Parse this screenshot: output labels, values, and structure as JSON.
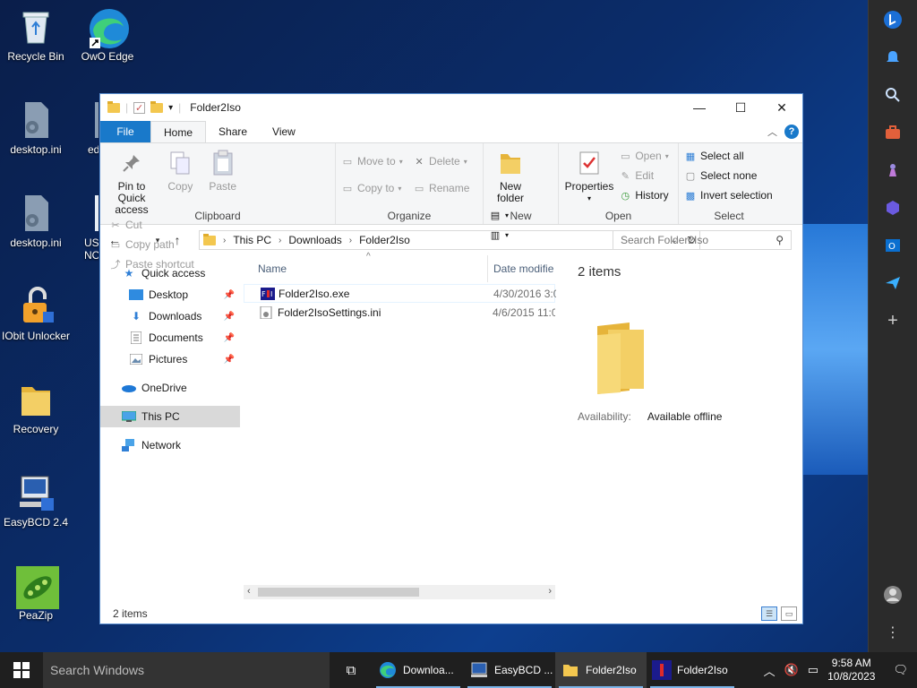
{
  "desktop": {
    "icons": [
      {
        "label": "Recycle Bin"
      },
      {
        "label": "OwO Edge"
      },
      {
        "label": "desktop.ini"
      },
      {
        "label": "ed"
      },
      {
        "label": "desktop.ini"
      },
      {
        "label": "USE NOW"
      },
      {
        "label": "IObit Unlocker"
      },
      {
        "label": "Recovery"
      },
      {
        "label": "EasyBCD 2.4"
      },
      {
        "label": "PeaZip"
      }
    ]
  },
  "window": {
    "title": "Folder2Iso",
    "controls": {
      "minimize": "—",
      "maximize": "☐",
      "close": "✕"
    }
  },
  "ribbon": {
    "tabs": {
      "file": "File",
      "home": "Home",
      "share": "Share",
      "view": "View"
    },
    "clipboard": {
      "group": "Clipboard",
      "pin": "Pin to Quick access",
      "copy": "Copy",
      "paste": "Paste",
      "cut": "Cut",
      "copy_path": "Copy path",
      "paste_shortcut": "Paste shortcut"
    },
    "organize": {
      "group": "Organize",
      "move_to": "Move to",
      "copy_to": "Copy to",
      "delete": "Delete",
      "rename": "Rename"
    },
    "new": {
      "group": "New",
      "new_folder": "New folder"
    },
    "open": {
      "group": "Open",
      "properties": "Properties",
      "open": "Open",
      "edit": "Edit",
      "history": "History"
    },
    "select": {
      "group": "Select",
      "select_all": "Select all",
      "select_none": "Select none",
      "invert": "Invert selection"
    }
  },
  "address": {
    "crumbs": [
      "This PC",
      "Downloads",
      "Folder2Iso"
    ],
    "search_placeholder": "Search Folder2Iso"
  },
  "nav": {
    "quick_access": "Quick access",
    "items": [
      {
        "label": "Desktop"
      },
      {
        "label": "Downloads"
      },
      {
        "label": "Documents"
      },
      {
        "label": "Pictures"
      }
    ],
    "onedrive": "OneDrive",
    "this_pc": "This PC",
    "network": "Network"
  },
  "files": {
    "col_name": "Name",
    "col_date": "Date modifie",
    "rows": [
      {
        "name": "Folder2Iso.exe",
        "date": "4/30/2016 3:0"
      },
      {
        "name": "Folder2IsoSettings.ini",
        "date": "4/6/2015 11:0"
      }
    ]
  },
  "details": {
    "count": "2 items",
    "availability_label": "Availability:",
    "availability_value": "Available offline"
  },
  "status": {
    "items": "2 items"
  },
  "taskbar": {
    "search": "Search Windows",
    "apps": [
      {
        "label": "Downloa..."
      },
      {
        "label": "EasyBCD ..."
      },
      {
        "label": "Folder2Iso"
      },
      {
        "label": "Folder2Iso"
      }
    ],
    "time": "9:58 AM",
    "date": "10/8/2023"
  },
  "colors": {
    "accent": "#1979ca",
    "folder": "#f3c74f",
    "taskbar": "#1f1f1f"
  }
}
